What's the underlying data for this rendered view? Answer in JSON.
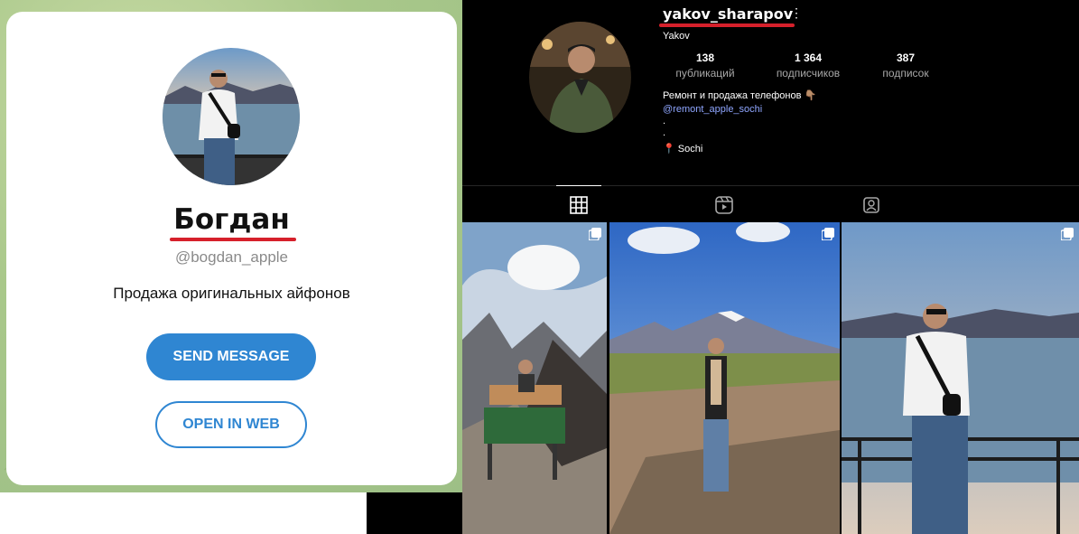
{
  "telegram": {
    "name": "Богдан",
    "username": "@bogdan_apple",
    "bio": "Продажа оригинальных айфонов",
    "send_message": "SEND MESSAGE",
    "open_in_web": "OPEN IN WEB",
    "accent": "#2f86d2"
  },
  "instagram": {
    "handle": "yakov_sharapov",
    "more": "⋮",
    "real_name": "Yakov ",
    "stats": [
      {
        "value": "138",
        "label": "публикаций"
      },
      {
        "value": "1 364",
        "label": "подписчиков"
      },
      {
        "value": "387",
        "label": "подписок"
      }
    ],
    "bio_line1": "Ремонт и продажа телефонов 👇🏽",
    "bio_link": "@remont_apple_sochi",
    "bio_dot1": ".",
    "bio_dot2": ".",
    "location": "📍 Sochi",
    "tabs": [
      "grid-icon",
      "reels-icon",
      "tagged-icon"
    ],
    "posts": [
      {
        "name": "post-mountain-bench",
        "multi": true
      },
      {
        "name": "post-volcano-field",
        "multi": true
      },
      {
        "name": "post-lake-rail",
        "multi": true
      }
    ],
    "underline_color": "#d6202b"
  }
}
